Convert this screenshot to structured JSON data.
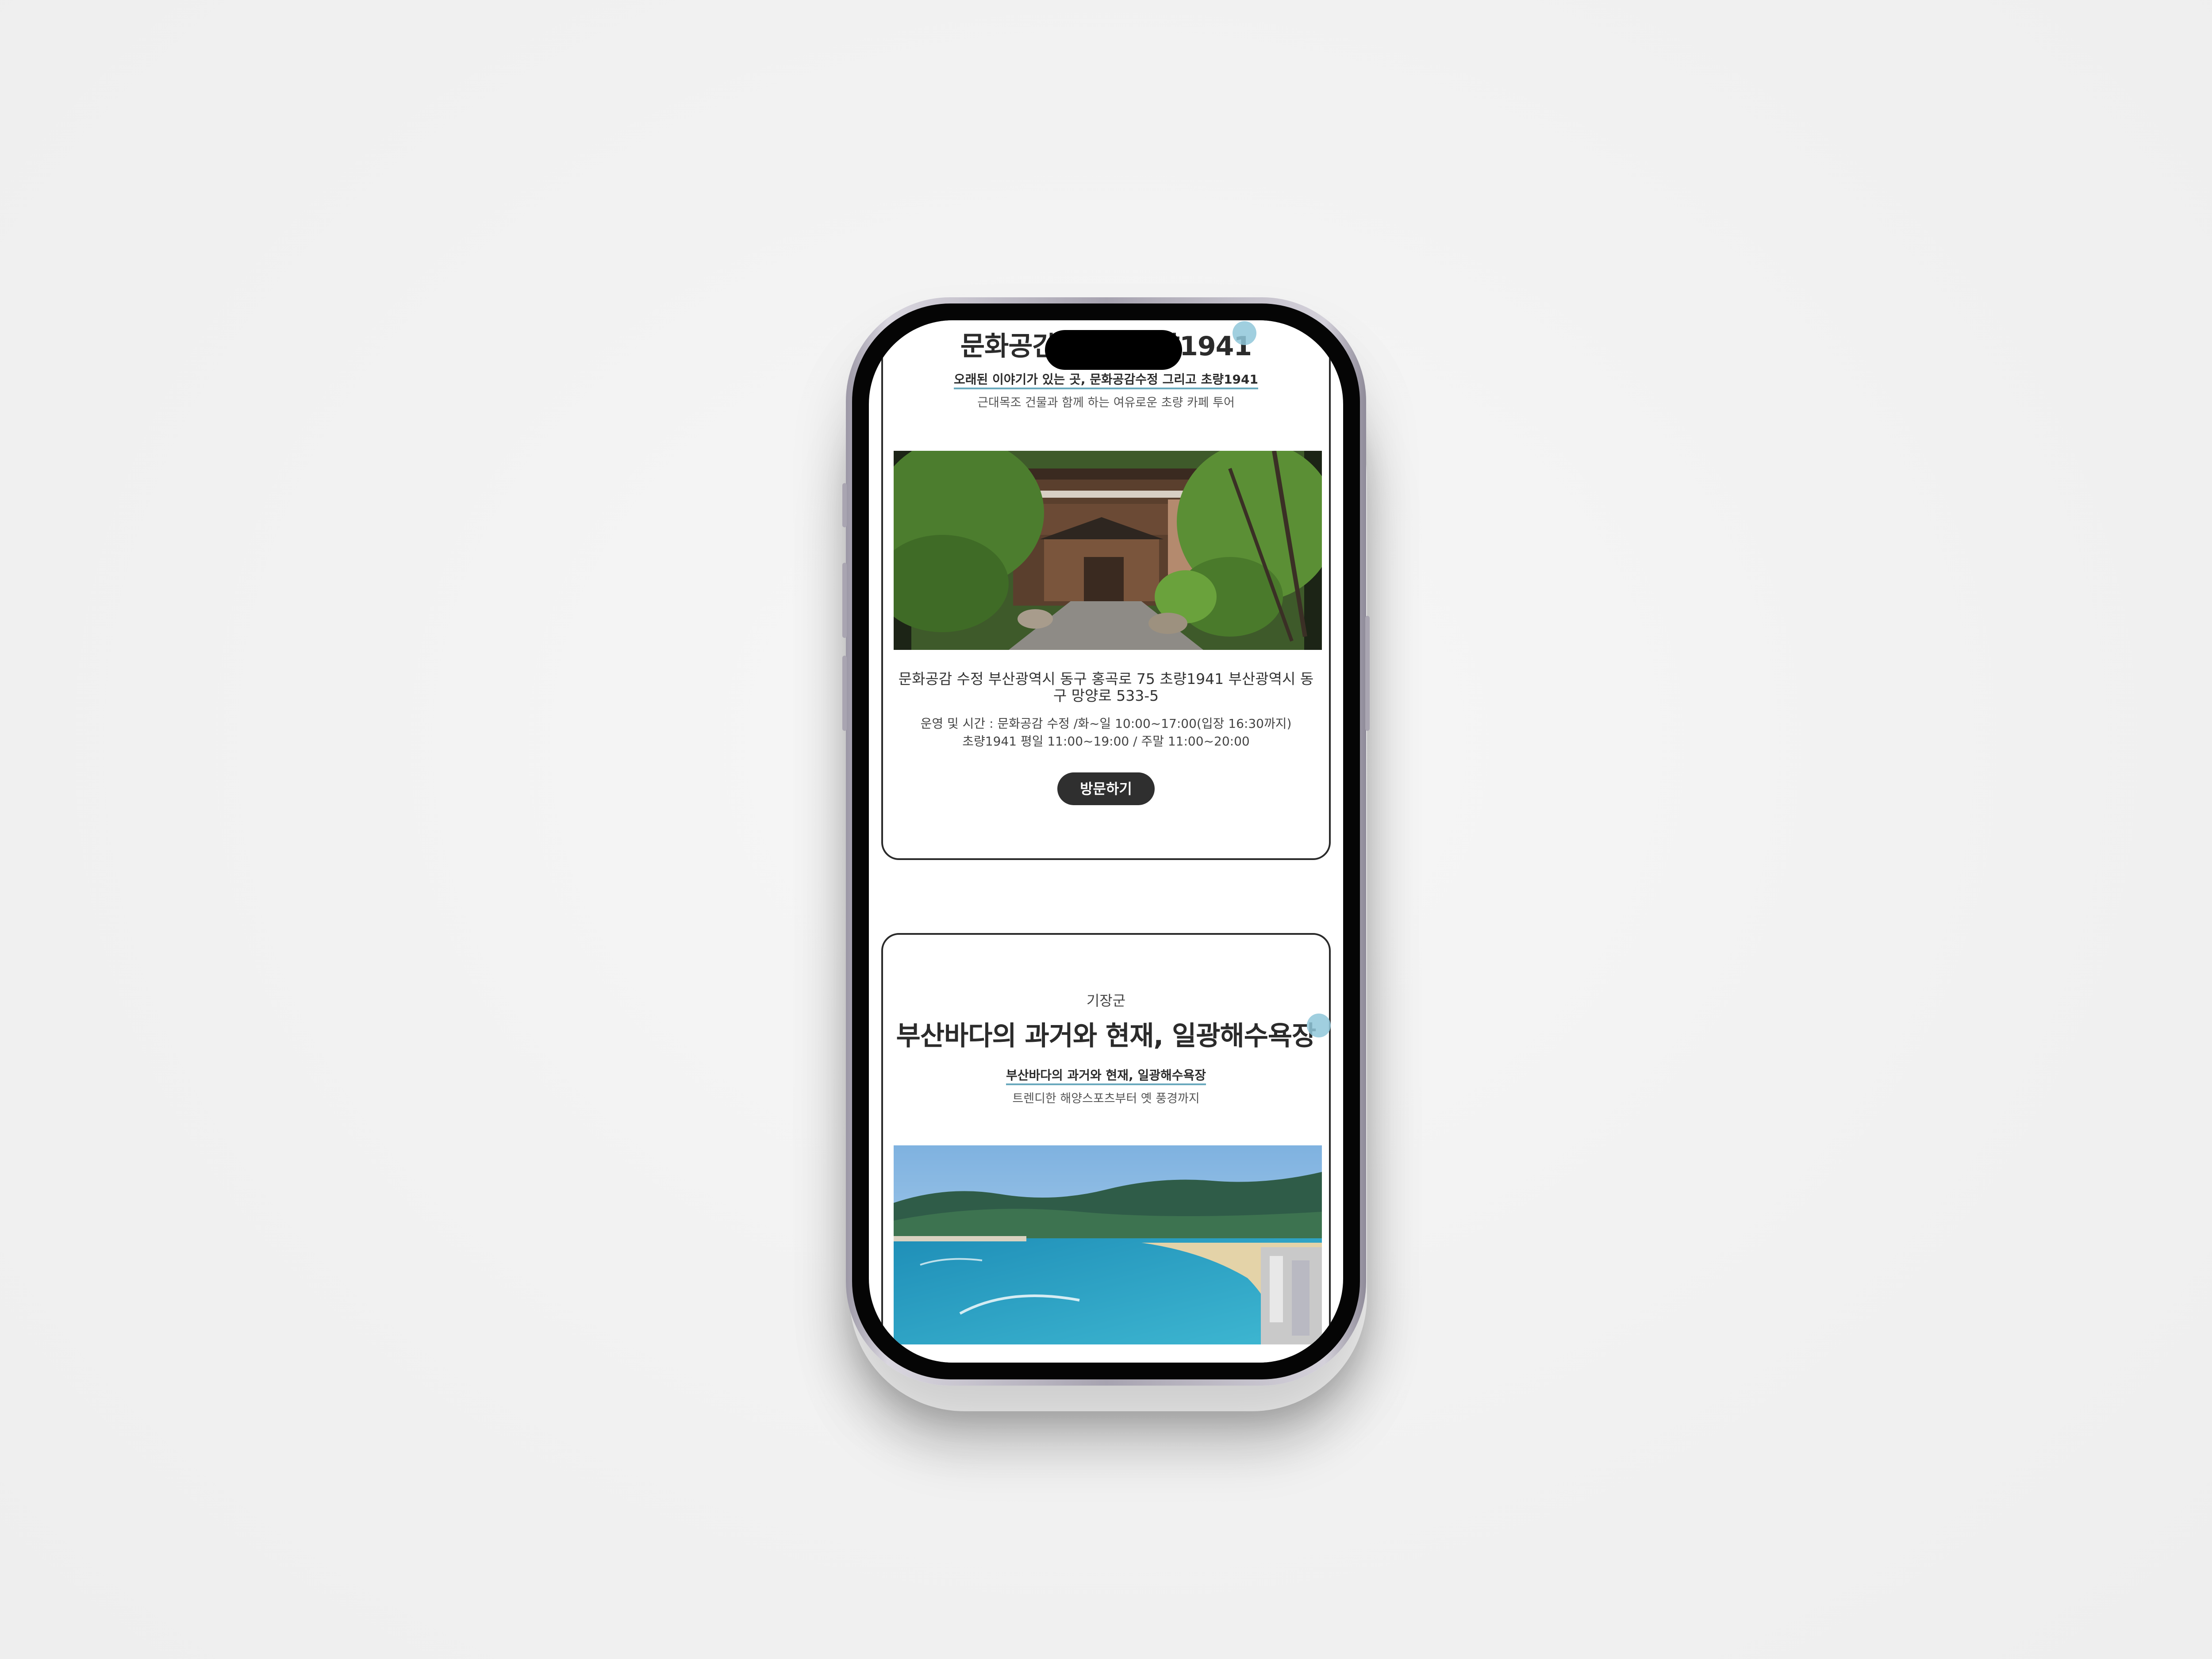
{
  "card1": {
    "title": "문화공간 수정, 초량1941",
    "subtitle": "오래된 이야기가 있는 곳, 문화공감수정 그리고 초량1941",
    "description": "근대목조 건물과 함께 하는 여유로운 초량 카페 투어",
    "address": "문화공감 수정 부산광역시 동구 홍곡로 75 초량1941 부산광역시 동구 망양로 533-5",
    "hours_line1": "운영 및 시간 : 문화공감 수정 /화~일 10:00~17:00(입장 16:30까지)",
    "hours_line2": "초량1941 평일 11:00~19:00 / 주말 11:00~20:00",
    "visit_label": "방문하기"
  },
  "card2": {
    "region": "기장군",
    "title": "부산바다의 과거와 현재, 일광해수욕장",
    "subtitle": "부산바다의 과거와 현재, 일광해수욕장",
    "description": "트렌디한 해양스포츠부터 옛 풍경까지"
  },
  "colors": {
    "accent_dot": "#8fc7d9",
    "button": "#2f2f2f",
    "text": "#2b2b2b"
  }
}
